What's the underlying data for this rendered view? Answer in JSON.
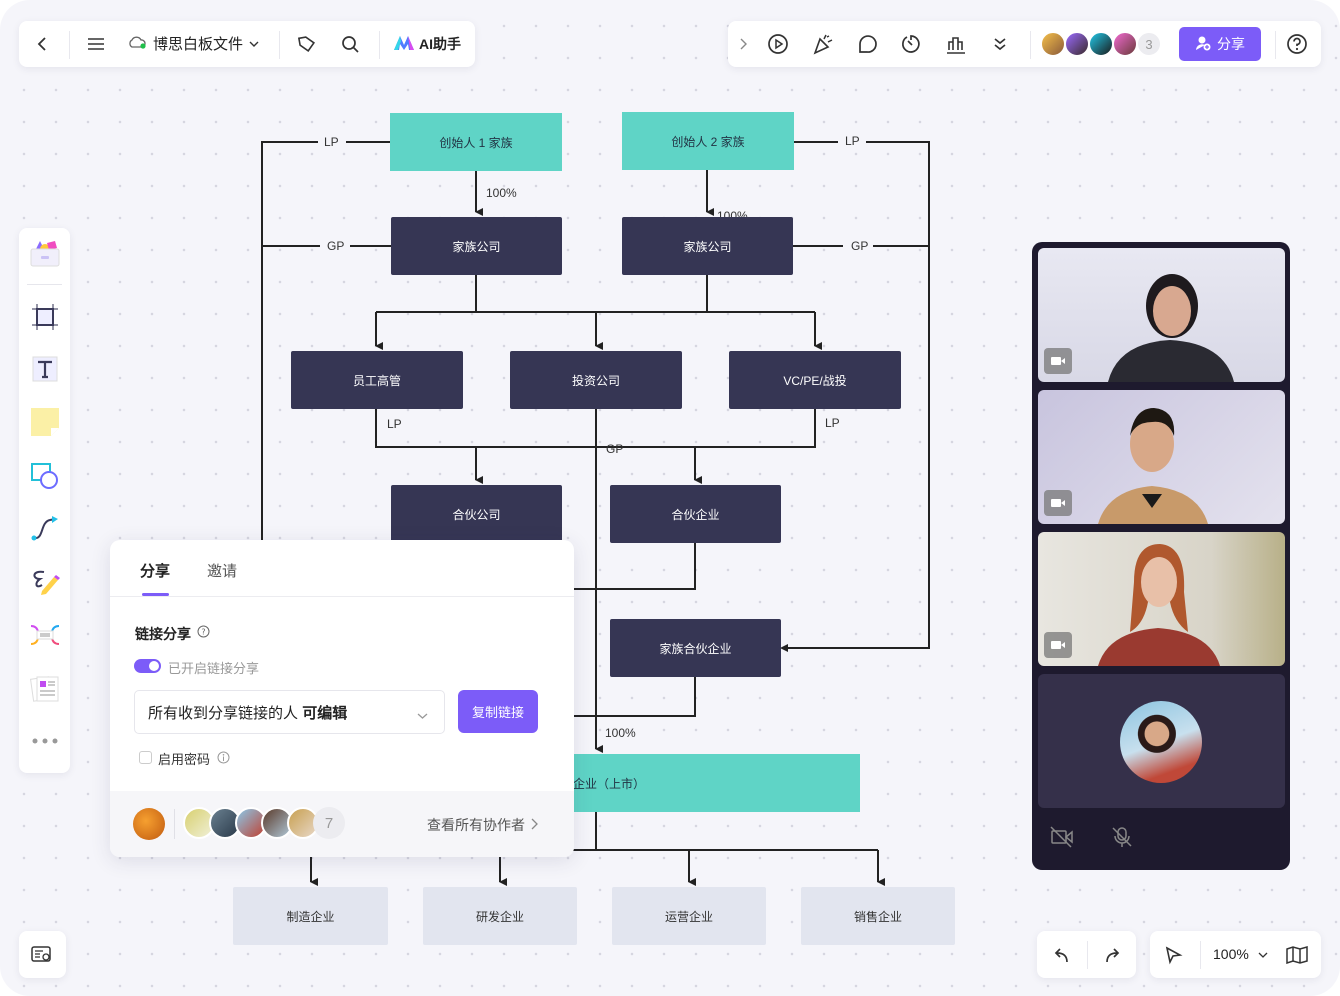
{
  "topbar_left": {
    "file_name": "博思白板文件",
    "ai_label": "AI助手",
    "icons": [
      "back-icon",
      "menu-icon",
      "cloud-sync-icon",
      "tag-icon",
      "search-icon",
      "ai-logo-icon"
    ]
  },
  "topbar_right": {
    "icons": [
      "expand-icon",
      "present-icon",
      "celebrate-icon",
      "comment-icon",
      "timer-icon",
      "vote-icon",
      "more-icon",
      "help-icon"
    ],
    "collaborator_overflow": "3",
    "share_label": "分享",
    "accent": "#7c5cf8"
  },
  "left_toolbar": {
    "tools": [
      "template-icon",
      "frame-icon",
      "text-icon",
      "sticky-note-icon",
      "shape-icon",
      "connector-icon",
      "pen-icon",
      "mindmap-icon",
      "document-icon",
      "more-icon"
    ]
  },
  "diagram": {
    "founder1": "创始人 1 家族",
    "founder2": "创始人 2 家族",
    "family_co1": "家族公司",
    "family_co2": "家族公司",
    "employees": "员工高管",
    "investment_co": "投资公司",
    "vc": "VC/PE/战投",
    "partner_co": "合伙公司",
    "partner_ent": "合伙企业",
    "family_partner_ent": "家族合伙企业",
    "listed": "企业（上市）",
    "subsidiaries": [
      "制造企业",
      "研发企业",
      "运营企业",
      "销售企业"
    ],
    "labels": {
      "lp": "LP",
      "gp": "GP",
      "pct": "100%"
    },
    "colors": {
      "teal": "#5fd4c6",
      "dark": "#363654",
      "light": "#e2e5ef"
    }
  },
  "share_panel": {
    "tabs": [
      "分享",
      "邀请"
    ],
    "active_tab": "分享",
    "section_title": "链接分享",
    "toggle_label": "已开启链接分享",
    "toggle_on": true,
    "permission_select": "所有收到分享链接的人",
    "permission_value": "可编辑",
    "copy_button": "复制链接",
    "password_label": "启用密码",
    "password_enabled": false,
    "collaborator_count": "7",
    "view_all": "查看所有协作者"
  },
  "video_panel": {
    "icons": [
      "camera-off-icon",
      "mic-off-icon"
    ]
  },
  "bottom_right": {
    "zoom": "100%"
  }
}
